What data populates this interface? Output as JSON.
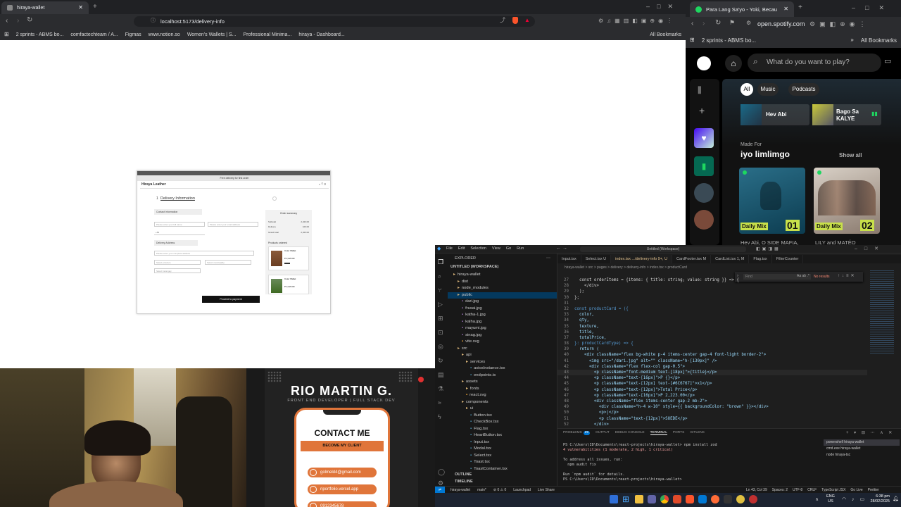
{
  "left_browser": {
    "tab_title": "hiraya-wallet",
    "url": "localhost:5173/delivery-info",
    "bookmarks": [
      "2 sprints - ABMS bo...",
      "comfactechteam / A...",
      "Figmas",
      "www.notion.so",
      "Women's Wallets | S...",
      "Professional Minima...",
      "hiraya - Dashboard..."
    ],
    "all_bookmarks": "All Bookmarks"
  },
  "webpage": {
    "banner": "Free delivery for first order",
    "brand": "Hiraya Leather",
    "step_label": "Delivery Information",
    "step_num": "1",
    "section_contact": "Contact information",
    "field_name": "Please enter your full name",
    "field_email": "Please enter your email address",
    "field_phone": "+63",
    "section_address": "Delivery Address",
    "field_address": "Please enter your complete address",
    "field_province": "Select province",
    "field_municipality": "Select municipality",
    "field_barangay": "Select barangay",
    "order_summary": "Order summary",
    "summary_rows": [
      [
        "Subtotal",
        "2,223.00"
      ],
      [
        "Delivery",
        "100.00"
      ],
      [
        "Grand total",
        "2,323.00"
      ]
    ],
    "products_ordered": "Products ordered",
    "products": [
      {
        "name": "Cuter Wallet",
        "price": "P 2,223.00"
      },
      {
        "name": "Cuter Wallet",
        "price": "P 2,223.00"
      }
    ],
    "proceed_btn": "Proceed to payment"
  },
  "spotify_browser": {
    "tab_title": "Para Lang Sa'yo - Yoki, Becau",
    "url": "open.spotify.com",
    "bookmark": "2 sprints - ABMS bo...",
    "all_bookmarks": "All Bookmarks",
    "search_placeholder": "What do you want to play?",
    "chips": [
      "All",
      "Music",
      "Podcasts"
    ],
    "shortcuts": [
      "Hev Abi",
      "Bago Sa KALYE"
    ],
    "made_for": "Made For",
    "section_title": "iyo limlimgo",
    "show_all": "Show all",
    "mixes": [
      {
        "label": "Daily Mix",
        "num": "01",
        "caption": "Hev Abi, O SIDE MAFIA,"
      },
      {
        "label": "Daily Mix",
        "num": "02",
        "caption": "LILY and MATÉO"
      }
    ]
  },
  "stream_overlay": {
    "name": "RIO MARTIN G.",
    "subtitle": "FRONT END DEVELOPER | FULL STACK DEV",
    "contact": "CONTACT ME",
    "cta": "BECOME MY CLIENT",
    "links": [
      "golmeld4@gmail.com",
      "riportfolio.vercel.app",
      "0912345678"
    ]
  },
  "vscode": {
    "title": "Untitled (Workspace)",
    "menu": [
      "File",
      "Edit",
      "Selection",
      "View",
      "Go",
      "Run"
    ],
    "tabs": [
      "Input.tsx",
      "Select.tsx U",
      "index.tsx .../delivery-info 9+, U",
      "CardFooter.tsx M",
      "CardList.tsx 1, M",
      "Flag.tsx",
      "FilterCounter"
    ],
    "breadcrumb": "hiraya-wallet > src > pages > delivery > delivery-info > index.tsx > productCard",
    "explorer_title": "EXPLORER",
    "workspace": "UNTITLED (WORKSPACE)",
    "tree": [
      "hiraya-wallet",
      "dist",
      "node_modules",
      "public",
      "dari.jpg",
      "frusai.jpg",
      "katha-1.jpg",
      "kalha.jpg",
      "mayumi.jpg",
      "sinag.jpg",
      "vite.svg",
      "src",
      "api",
      "services",
      "axiosInstance.tsx",
      "endpoints.ts",
      "assets",
      "fonts",
      "react.svg",
      "components",
      "ui",
      "Button.tsx",
      "CheckBox.tsx",
      "Flag.tsx",
      "HeartButton.tsx",
      "Input.tsx",
      "Modal.tsx",
      "Select.tsx",
      "Toast.tsx",
      "ToastContainer.tsx"
    ],
    "outline": "OUTLINE",
    "timeline": "TIMELINE",
    "find_placeholder": "Find",
    "find_result": "No results",
    "code": [
      [
        "27",
        "  const orderItems = {items: { title: string; value: string }} => {"
      ],
      [
        "28",
        "    </div>"
      ],
      [
        "29",
        "  );"
      ],
      [
        "30",
        "};"
      ],
      [
        "31",
        ""
      ],
      [
        "32",
        "const productCard = ({"
      ],
      [
        "33",
        "  color,"
      ],
      [
        "34",
        "  qty,"
      ],
      [
        "35",
        "  texture,"
      ],
      [
        "36",
        "  title,"
      ],
      [
        "37",
        "  totalPrice,"
      ],
      [
        "38",
        "}: productCardType) => {"
      ],
      [
        "39",
        "  return ("
      ],
      [
        "40",
        "    <div className=\"flex bg-white p-4 items-center gap-4 font-light border-2\">"
      ],
      [
        "41",
        "      <img src=\"/dari.jpg\" alt=\"\" className=\"h-[130px]\" />"
      ],
      [
        "42",
        "      <div className=\"flex flex-col gap-0.5\">"
      ],
      [
        "43",
        "        <p className=\"font-medium text-[18px]\">{title}</p>"
      ],
      [
        "44",
        "        <p className=\"text-[16px]\">P {}</p>"
      ],
      [
        "45",
        "        <p className=\"text-[12px] text-[#6C6767]\">x1</p>"
      ],
      [
        "46",
        "        <p className=\"text-[12px]\">Total Price</p>"
      ],
      [
        "47",
        "        <p className=\"text-[16px]\">P 2,223.00</p>"
      ],
      [
        "48",
        "        <div className=\"flex items-center gap-2 mb-2\">"
      ],
      [
        "49",
        "          <div className=\"h-4 w-10\" style={{ backgroundColor: \"brown\" }}></div>"
      ],
      [
        "50",
        "          <p>|</p>"
      ],
      [
        "51",
        "          <p className=\"text-[12px]\">SUEDE</p>"
      ],
      [
        "52",
        "        </div>"
      ]
    ],
    "panel_tabs": [
      "PROBLEMS",
      "OUTPUT",
      "DEBUG CONSOLE",
      "TERMINAL",
      "PORTS",
      "GITLENS"
    ],
    "problems_count": "29",
    "terminal": [
      "PS C:\\Users\\ID\\Documents\\react-projects\\hiraya-wallet> npm install zod",
      "4 vulnerabilities (1 moderate, 2 high, 1 critical)",
      "",
      "To address all issues, run:",
      "  npm audit fix",
      "",
      "Run `npm audit` for details.",
      "PS C:\\Users\\ID\\Documents\\react-projects\\hiraya-wallet> "
    ],
    "terminals": [
      "powershell hiraya-wallet",
      "cmd.exe hiraya-wallet",
      "node hiraya-tsc"
    ],
    "status_left": [
      "hiraya-wallet",
      "main*",
      "⊘ 0 ⚠ 0",
      "Launchpad",
      "Live Share"
    ],
    "status_right": [
      "Ln 43, Col 39",
      "Spaces: 2",
      "UTF-8",
      "CRLF",
      "TypeScript JSX",
      "Go Live",
      "Prettier"
    ]
  },
  "taskbar": {
    "lang": "ENG",
    "region": "US",
    "time": "6:38 pm",
    "date": "28/02/2025"
  },
  "colors": {
    "chrome_dark": "#202124",
    "spotify_bg": "#121212",
    "vscode_bg": "#1e1e1e",
    "accent_orange": "#e0753a",
    "taskbar": "#1c2330"
  }
}
